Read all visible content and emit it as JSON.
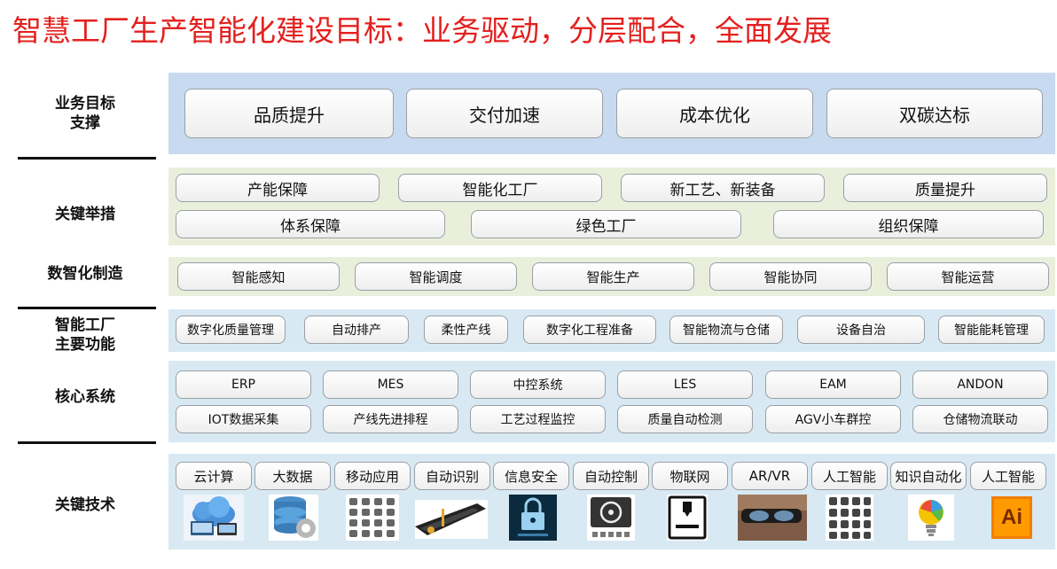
{
  "title": "智慧工厂生产智能化建设目标：业务驱动，分层配合，全面发展",
  "rows": {
    "goals": {
      "label": "业务目标\n支撑",
      "items": [
        "品质提升",
        "交付加速",
        "成本优化",
        "双碳达标"
      ]
    },
    "key_measures": {
      "label": "关键举措",
      "items_row1": [
        "产能保障",
        "智能化工厂",
        "新工艺、新装备",
        "质量提升"
      ],
      "items_row2": [
        "体系保障",
        "绿色工厂",
        "组织保障"
      ]
    },
    "digital_manufacturing": {
      "label": "数智化制造",
      "items": [
        "智能感知",
        "智能调度",
        "智能生产",
        "智能协同",
        "智能运营"
      ]
    },
    "main_functions": {
      "label": "智能工厂\n主要功能",
      "items": [
        "数字化质量管理",
        "自动排产",
        "柔性产线",
        "数字化工程准备",
        "智能物流与仓储",
        "设备自治",
        "智能能耗管理"
      ]
    },
    "core_systems": {
      "label": "核心系统",
      "items_row1": [
        "ERP",
        "MES",
        "中控系统",
        "LES",
        "EAM",
        "ANDON"
      ],
      "items_row2": [
        "IOT数据采集",
        "产线先进排程",
        "工艺过程监控",
        "质量自动检测",
        "AGV小车群控",
        "仓储物流联动"
      ]
    },
    "key_technologies": {
      "label": "关键技术",
      "items": [
        "云计算",
        "大数据",
        "移动应用",
        "自动识别",
        "信息安全",
        "自动控制",
        "物联网",
        "AR/VR",
        "人工智能",
        "知识自动化",
        "人工智能"
      ],
      "icons": [
        "cloud-devices-icon",
        "database-gear-icon",
        "mobile-apps-grid-icon",
        "barcode-scanner-icon",
        "security-lock-icon",
        "automatic-control-icon",
        "iot-3d-printer-icon",
        "ar-vr-glasses-icon",
        "robot-ai-icon",
        "knowledge-lightbulb-icon",
        "ai-logo-icon"
      ],
      "ai_logo_text": "Ai"
    }
  },
  "colors": {
    "title": "#e3201e",
    "goals_band": "#c7daf0",
    "measures_band": "#eaefdc",
    "system_band": "#d8e9f3"
  }
}
